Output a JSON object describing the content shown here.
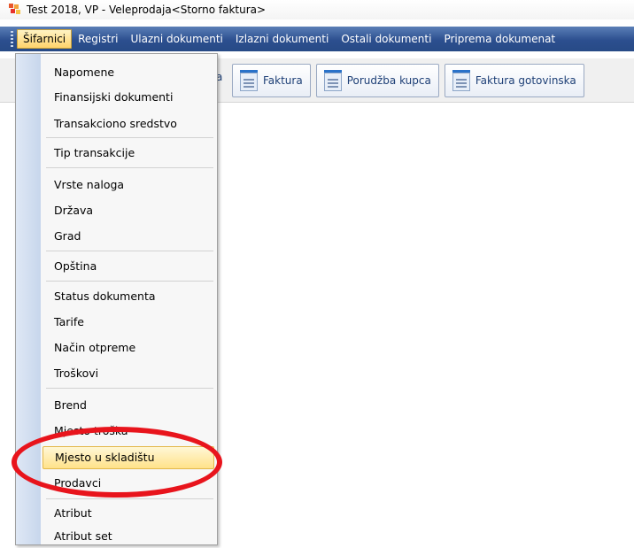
{
  "window": {
    "title": "Test 2018, VP - Veleprodaja<Storno faktura>"
  },
  "menubar": {
    "items": [
      "Šifarnici",
      "Registri",
      "Ulazni dokumenti",
      "Izlazni dokumenti",
      "Ostali dokumenti",
      "Priprema dokumenat"
    ],
    "active_index": 0
  },
  "toolbar": {
    "lead_text": "a",
    "buttons": [
      {
        "label": "Faktura",
        "icon": "document-icon"
      },
      {
        "label": "Porudžba kupca",
        "icon": "document-icon"
      },
      {
        "label": "Faktura gotovinska",
        "icon": "document-icon"
      }
    ]
  },
  "dropdown": {
    "items": [
      "Napomene",
      "Finansijski dokumenti",
      "Transakciono sredstvo",
      "Tip transakcije",
      "Vrste naloga",
      "Država",
      "Grad",
      "Opština",
      "Status dokumenta",
      "Tarife",
      "Način otpreme",
      "Troškovi",
      "Brend",
      "Mjesto troška",
      "Mjesto u skladištu",
      "Prodavci",
      "Atribut",
      "Atribut set"
    ],
    "highlighted": "Mjesto u skladištu"
  },
  "annotation": {
    "color": "#e8141c",
    "shape": "red-ellipse"
  },
  "colors": {
    "menubar": "#2c4f8f",
    "highlight": "#ffe28a",
    "accent": "#2a72c9"
  }
}
